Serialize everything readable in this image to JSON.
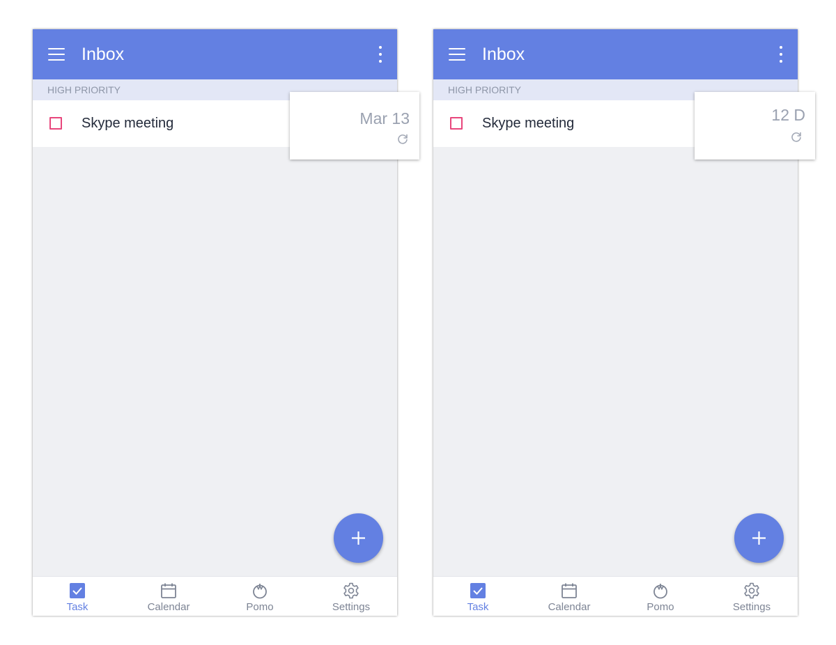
{
  "colors": {
    "primary": "#6380e2",
    "priority_high": "#e8467c",
    "background": "#eff0f3"
  },
  "screens": [
    {
      "appbar": {
        "title": "Inbox",
        "menu_icon": "hamburger-menu-icon",
        "more_icon": "more-vertical-icon"
      },
      "section": {
        "label": "HIGH PRIORITY"
      },
      "task": {
        "title": "Skype meeting"
      },
      "popup": {
        "date": "Mar 13",
        "icon": "repeat-icon"
      },
      "fab": {
        "icon": "plus-icon"
      },
      "nav": [
        {
          "label": "Task",
          "icon": "task-checkbox-icon",
          "active": true
        },
        {
          "label": "Calendar",
          "icon": "calendar-icon",
          "active": false
        },
        {
          "label": "Pomo",
          "icon": "pomodoro-tomato-icon",
          "active": false
        },
        {
          "label": "Settings",
          "icon": "gear-icon",
          "active": false
        }
      ]
    },
    {
      "appbar": {
        "title": "Inbox",
        "menu_icon": "hamburger-menu-icon",
        "more_icon": "more-vertical-icon"
      },
      "section": {
        "label": "HIGH PRIORITY"
      },
      "task": {
        "title": "Skype meeting"
      },
      "popup": {
        "date": "12 D",
        "icon": "repeat-icon"
      },
      "fab": {
        "icon": "plus-icon"
      },
      "nav": [
        {
          "label": "Task",
          "icon": "task-checkbox-icon",
          "active": true
        },
        {
          "label": "Calendar",
          "icon": "calendar-icon",
          "active": false
        },
        {
          "label": "Pomo",
          "icon": "pomodoro-tomato-icon",
          "active": false
        },
        {
          "label": "Settings",
          "icon": "gear-icon",
          "active": false
        }
      ]
    }
  ]
}
